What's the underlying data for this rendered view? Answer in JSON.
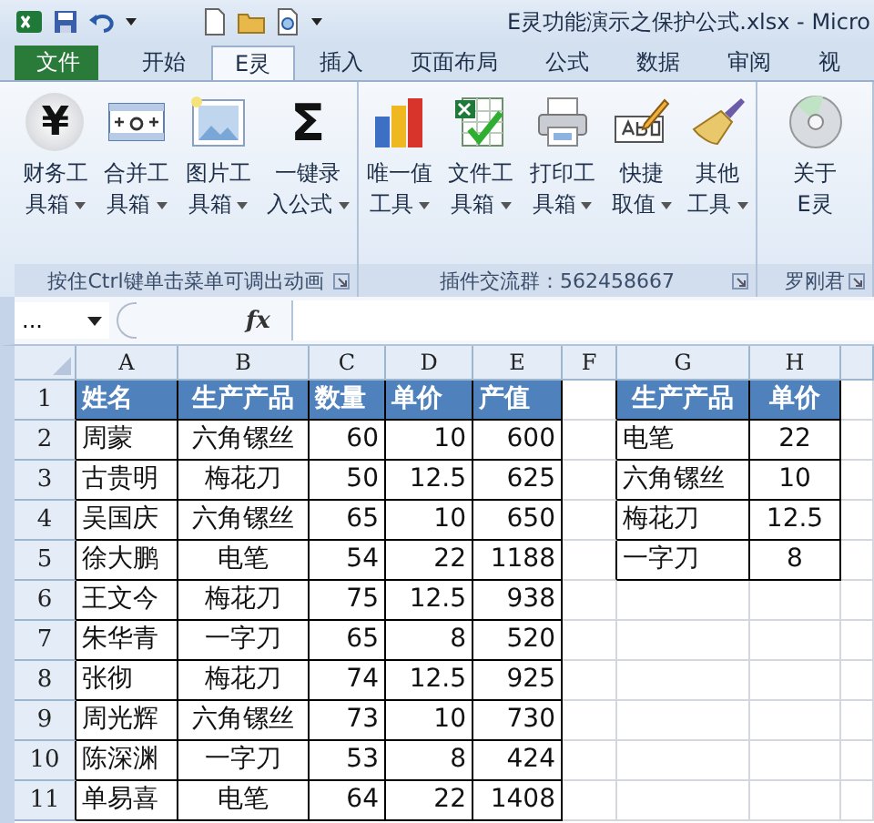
{
  "window": {
    "title": "E灵功能演示之保护公式.xlsx - Micro"
  },
  "tabs": [
    {
      "label": "文件",
      "selected": false,
      "kind": "file"
    },
    {
      "label": "开始",
      "selected": false,
      "kind": "tab"
    },
    {
      "label": "E灵",
      "selected": true,
      "kind": "tab"
    },
    {
      "label": "插入",
      "selected": false,
      "kind": "tab"
    },
    {
      "label": "页面布局",
      "selected": false,
      "kind": "tab"
    },
    {
      "label": "公式",
      "selected": false,
      "kind": "tab"
    },
    {
      "label": "数据",
      "selected": false,
      "kind": "tab"
    },
    {
      "label": "审阅",
      "selected": false,
      "kind": "tab"
    },
    {
      "label": "视",
      "selected": false,
      "kind": "tab"
    }
  ],
  "ribbon_groups": [
    {
      "label": "按住Ctrl键单击菜单可调出动画",
      "launcher": true,
      "buttons": [
        {
          "lines": [
            "财务工",
            "具箱"
          ],
          "dropdown": true,
          "glyph": "¥"
        },
        {
          "lines": [
            "合并工",
            "具箱"
          ],
          "dropdown": true
        },
        {
          "lines": [
            "图片工",
            "具箱"
          ],
          "dropdown": true
        },
        {
          "lines": [
            "一键录",
            "入公式"
          ],
          "dropdown": true,
          "glyph": "Σ"
        }
      ]
    },
    {
      "label": "插件交流群：562458667",
      "launcher": true,
      "buttons": [
        {
          "lines": [
            "唯一值",
            "工具"
          ],
          "dropdown": true
        },
        {
          "lines": [
            "文件工",
            "具箱"
          ],
          "dropdown": true
        },
        {
          "lines": [
            "打印工",
            "具箱"
          ],
          "dropdown": true
        },
        {
          "lines": [
            "快捷",
            "取值"
          ],
          "dropdown": true
        },
        {
          "lines": [
            "其他",
            "工具"
          ],
          "dropdown": true
        }
      ]
    },
    {
      "label": "罗刚君",
      "launcher": true,
      "buttons": [
        {
          "lines": [
            "关于",
            "E灵"
          ],
          "dropdown": false
        }
      ]
    }
  ],
  "formula_bar": {
    "name_box": "...",
    "fx": "fx"
  },
  "sheet": {
    "columns": [
      "A",
      "B",
      "C",
      "D",
      "E",
      "F",
      "G",
      "H"
    ],
    "row_numbers": [
      "1",
      "2",
      "3",
      "4",
      "5",
      "6",
      "7",
      "8",
      "9",
      "10",
      "11"
    ],
    "main_table": {
      "header": [
        "姓名",
        "生产产品",
        "数量",
        "单价",
        "产值"
      ],
      "rows": [
        [
          "周蒙",
          "六角镙丝",
          "60",
          "10",
          "600"
        ],
        [
          "古贵明",
          "梅花刀",
          "50",
          "12.5",
          "625"
        ],
        [
          "吴国庆",
          "六角镙丝",
          "65",
          "10",
          "650"
        ],
        [
          "徐大鹏",
          "电笔",
          "54",
          "22",
          "1188"
        ],
        [
          "王文今",
          "梅花刀",
          "75",
          "12.5",
          "938"
        ],
        [
          "朱华青",
          "一字刀",
          "65",
          "8",
          "520"
        ],
        [
          "张彻",
          "梅花刀",
          "74",
          "12.5",
          "925"
        ],
        [
          "周光辉",
          "六角镙丝",
          "73",
          "10",
          "730"
        ],
        [
          "陈深渊",
          "一字刀",
          "53",
          "8",
          "424"
        ],
        [
          "单易喜",
          "电笔",
          "64",
          "22",
          "1408"
        ]
      ]
    },
    "lookup_table": {
      "header": [
        "生产产品",
        "单价"
      ],
      "rows": [
        [
          "电笔",
          "22"
        ],
        [
          "六角镙丝",
          "10"
        ],
        [
          "梅花刀",
          "12.5"
        ],
        [
          "一字刀",
          "8"
        ]
      ]
    }
  }
}
